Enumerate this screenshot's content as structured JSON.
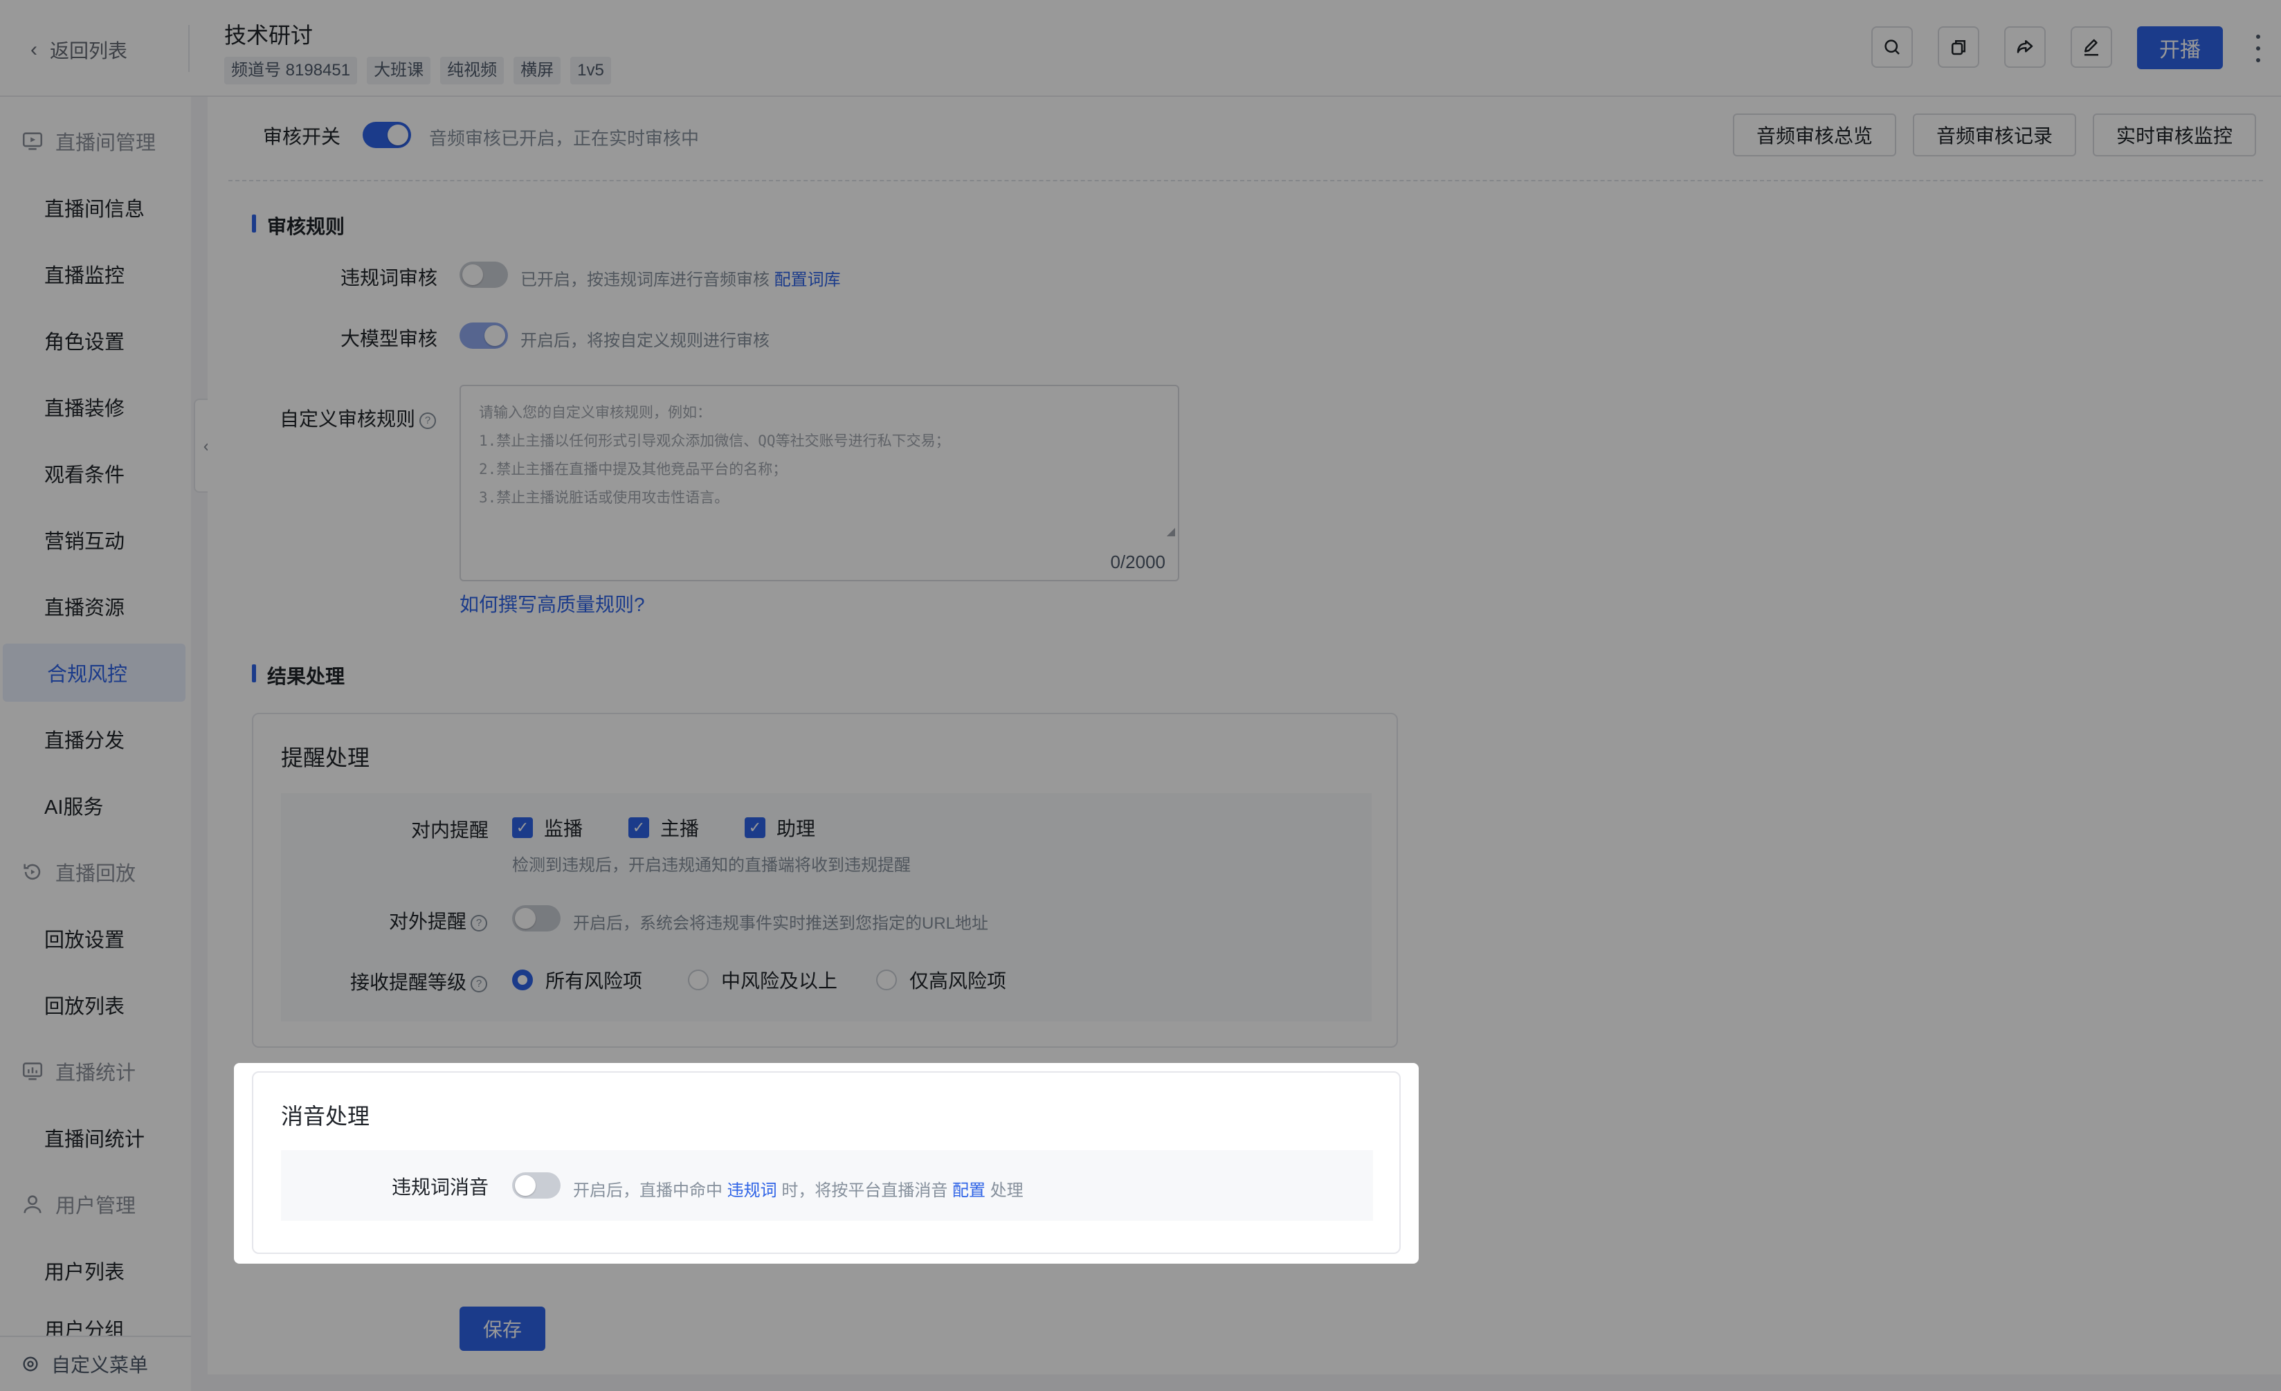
{
  "header": {
    "back_label": "返回列表",
    "title": "技术研讨",
    "tags": [
      "频道号 8198451",
      "大班课",
      "纯视频",
      "横屏",
      "1v5"
    ],
    "start_label": "开播"
  },
  "sidebar": {
    "groups": [
      {
        "label": "直播间管理",
        "icon": "monitor-play-icon"
      },
      {
        "label": "直播回放",
        "icon": "replay-icon"
      },
      {
        "label": "直播统计",
        "icon": "chart-icon"
      },
      {
        "label": "用户管理",
        "icon": "user-icon"
      }
    ],
    "items": [
      "直播间信息",
      "直播监控",
      "角色设置",
      "直播装修",
      "观看条件",
      "营销互动",
      "直播资源",
      "合规风控",
      "直播分发",
      "AI服务",
      "回放设置",
      "回放列表",
      "直播间统计",
      "用户列表",
      "用户分组"
    ],
    "active_item": "合规风控",
    "footer_label": "自定义菜单"
  },
  "audit": {
    "switch_label": "审核开关",
    "switch_on": true,
    "switch_hint": "音频审核已开启，正在实时审核中",
    "buttons": [
      "音频审核总览",
      "音频审核记录",
      "实时审核监控"
    ]
  },
  "rules": {
    "section_title": "审核规则",
    "violation_label": "违规词审核",
    "violation_on": false,
    "violation_hint": "已开启，按违规词库进行音频审核",
    "violation_link": "配置词库",
    "llm_label": "大模型审核",
    "llm_on": true,
    "llm_hint": "开启后，将按自定义规则进行审核",
    "custom_label": "自定义审核规则",
    "placeholder": "请输入您的自定义审核规则，例如：\n1.禁止主播以任何形式引导观众添加微信、QQ等社交账号进行私下交易；\n2.禁止主播在直播中提及其他竞品平台的名称；\n3.禁止主播说脏话或使用攻击性语言。",
    "count": "0/2000",
    "help_link": "如何撰写高质量规则?"
  },
  "result": {
    "section_title": "结果处理",
    "reminder": {
      "title": "提醒处理",
      "internal_label": "对内提醒",
      "internal_options": [
        "监播",
        "主播",
        "助理"
      ],
      "internal_hint": "检测到违规后，开启违规通知的直播端将收到违规提醒",
      "external_label": "对外提醒",
      "external_on": false,
      "external_hint": "开启后，系统会将违规事件实时推送到您指定的URL地址",
      "level_label": "接收提醒等级",
      "levels": [
        "所有风险项",
        "中风险及以上",
        "仅高风险项"
      ],
      "level_selected": "所有风险项"
    },
    "mute": {
      "title": "消音处理",
      "label": "违规词消音",
      "on": false,
      "hint_1": "开启后，直播中命中",
      "hint_link_1": "违规词",
      "hint_2": "时，将按平台直播消音",
      "hint_link_2": "配置",
      "hint_3": "处理"
    }
  },
  "save_label": "保存",
  "colors": {
    "accent": "#2e63e6",
    "overlay": "rgba(0,0,0,0.40)"
  }
}
